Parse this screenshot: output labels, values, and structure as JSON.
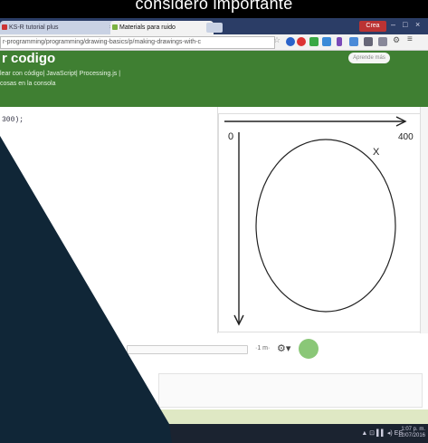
{
  "caption": "considero importante",
  "browser": {
    "tabs": [
      {
        "label": "KS-R tutorial plus"
      },
      {
        "label": "Materials para ruido"
      }
    ],
    "user_label": "Crea",
    "url": "r-programming/programming/drawing-basics/p/making-drawings-with-c"
  },
  "page": {
    "title": "r codigo",
    "subtitle_1": "lear con código| JavaScript| Processing.js |",
    "subtitle_2": "cosas en la consola",
    "right_button": "Aprende más"
  },
  "editor": {
    "code_line": "300);"
  },
  "canvas": {
    "left_label": "0",
    "right_label": "400",
    "marker_label": "X"
  },
  "toolbar": {
    "speed_label": "·1 m·"
  },
  "taskbar": {
    "tray_text": "ES",
    "clock_time": "1:07 p. m.",
    "clock_date": "12/07/2016"
  },
  "colors": {
    "header_green": "#3f7f32",
    "overlay_navy": "#102637",
    "taskbar": "#1b2330"
  },
  "icons": [
    "gear-icon",
    "owl-avatar-icon",
    "star-icon",
    "settings-icon"
  ]
}
